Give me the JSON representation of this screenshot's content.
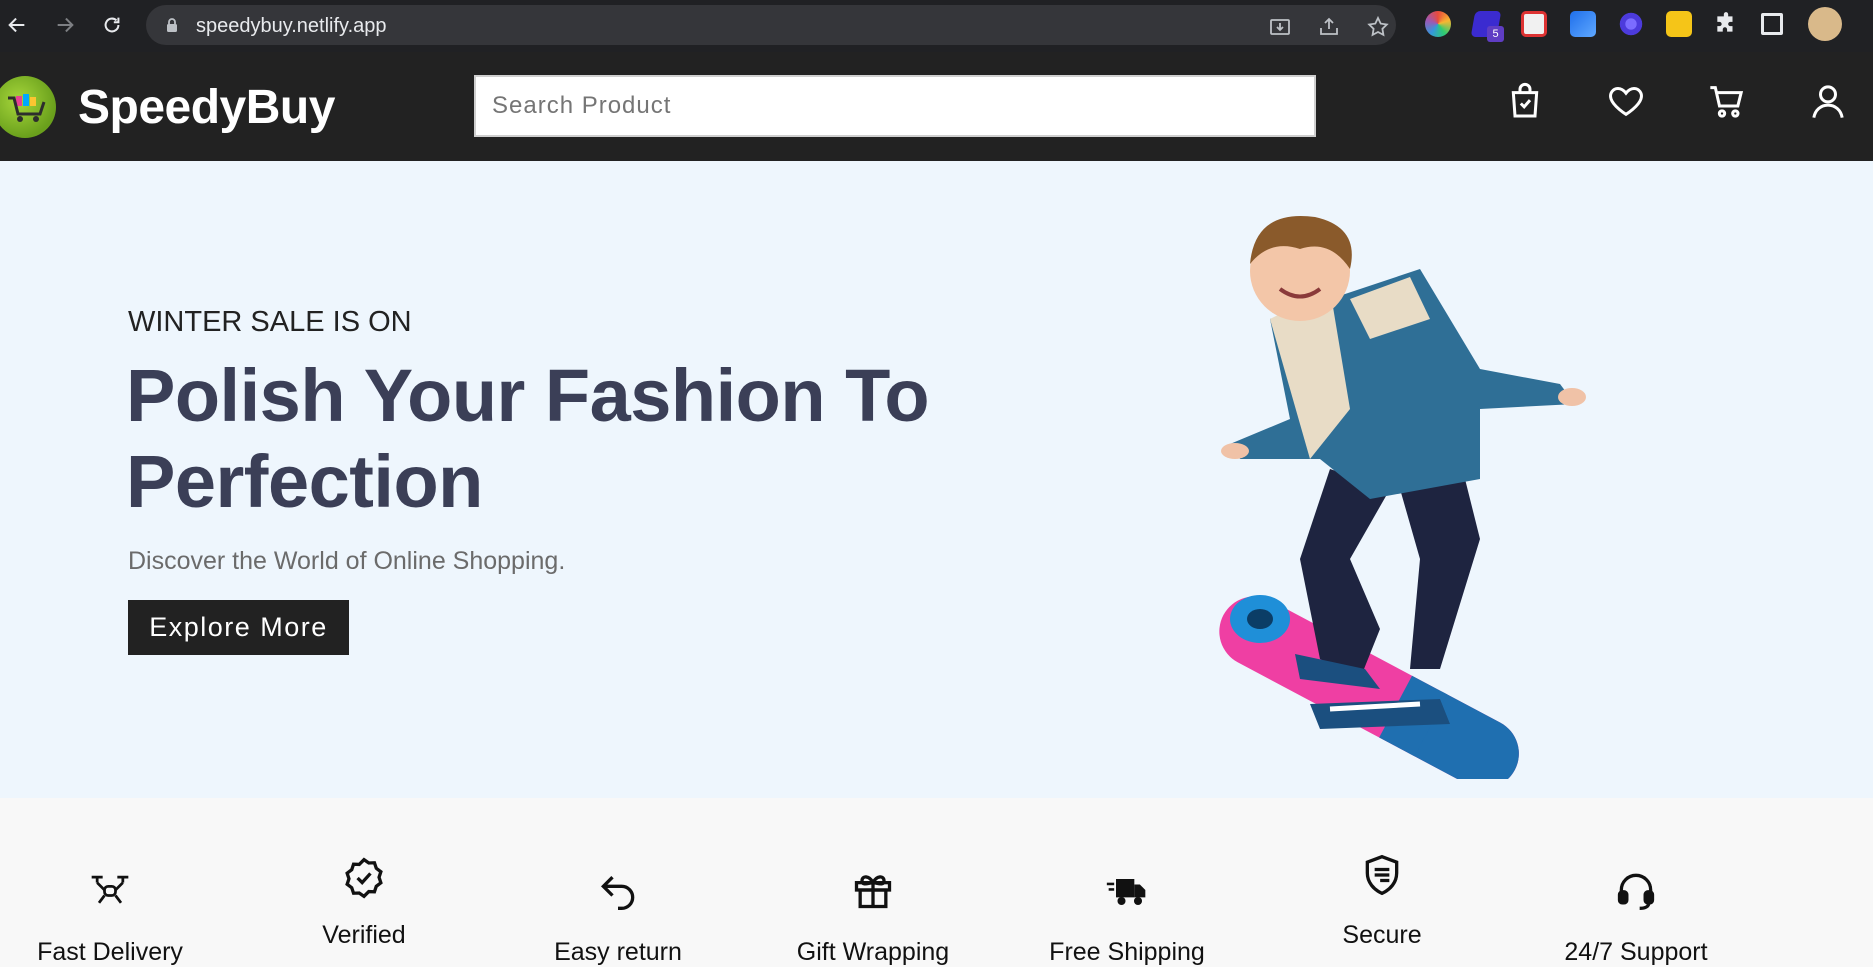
{
  "browser": {
    "url": "speedybuy.netlify.app",
    "extension_badge": "5"
  },
  "header": {
    "brand": "SpeedyBuy",
    "search": {
      "placeholder": "Search Product",
      "value": ""
    }
  },
  "hero": {
    "kicker": "WINTER SALE IS ON",
    "headline": "Polish Your Fashion To Perfection",
    "subtitle": "Discover the World of Online Shopping.",
    "cta_label": "Explore More"
  },
  "features": [
    {
      "label": "Fast Delivery",
      "icon": "drone-icon"
    },
    {
      "label": "Verified",
      "icon": "verified-badge-icon"
    },
    {
      "label": "Easy return",
      "icon": "return-arrow-icon"
    },
    {
      "label": "Gift Wrapping",
      "icon": "gift-icon"
    },
    {
      "label": "Free Shipping",
      "icon": "truck-icon"
    },
    {
      "label": "Secure",
      "icon": "shield-icon"
    },
    {
      "label": "24/7 Support",
      "icon": "headset-icon"
    }
  ]
}
